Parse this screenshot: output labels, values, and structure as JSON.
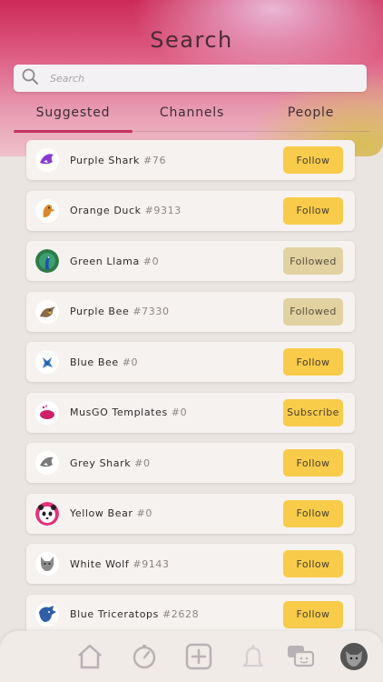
{
  "header": {
    "title": "Search",
    "search_placeholder": "Search"
  },
  "tabs": [
    {
      "label": "Suggested",
      "active": true
    },
    {
      "label": "Channels",
      "active": false
    },
    {
      "label": "People",
      "active": false
    }
  ],
  "colors": {
    "accent": "#c8275a",
    "follow_button": "#f8cc4a",
    "followed_button": "#e2d2a2"
  },
  "results": [
    {
      "name": "Purple Shark",
      "tag": "#76",
      "action": "Follow",
      "avatar_icon": "purple-shark-icon"
    },
    {
      "name": "Orange Duck",
      "tag": "#9313",
      "action": "Follow",
      "avatar_icon": "orange-duck-icon"
    },
    {
      "name": "Green Llama",
      "tag": "#0",
      "action": "Followed",
      "avatar_icon": "peacock-icon"
    },
    {
      "name": "Purple Bee",
      "tag": "#7330",
      "action": "Followed",
      "avatar_icon": "bird-icon"
    },
    {
      "name": "Blue Bee",
      "tag": "#0",
      "action": "Follow",
      "avatar_icon": "blue-bee-icon"
    },
    {
      "name": "MusGO Templates",
      "tag": "#0",
      "action": "Subscribe",
      "avatar_icon": "musgo-logo-icon"
    },
    {
      "name": "Grey Shark",
      "tag": "#0",
      "action": "Follow",
      "avatar_icon": "grey-shark-icon"
    },
    {
      "name": "Yellow Bear",
      "tag": "#0",
      "action": "Follow",
      "avatar_icon": "panda-icon"
    },
    {
      "name": "White Wolf",
      "tag": "#9143",
      "action": "Follow",
      "avatar_icon": "wolf-icon"
    },
    {
      "name": "Blue Triceratops",
      "tag": "#2628",
      "action": "Follow",
      "avatar_icon": "triceratops-icon"
    }
  ],
  "tabbar": [
    {
      "name": "home",
      "icon": "home-icon"
    },
    {
      "name": "explore",
      "icon": "compass-icon"
    },
    {
      "name": "create",
      "icon": "plus-square-icon"
    },
    {
      "name": "notifications",
      "icon": "bell-icon"
    },
    {
      "name": "messages",
      "icon": "chat-icon"
    },
    {
      "name": "profile",
      "icon": "profile-avatar-icon"
    }
  ]
}
